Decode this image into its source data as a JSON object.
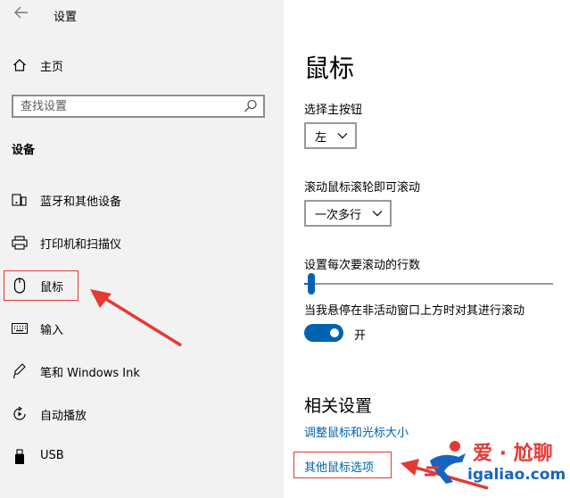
{
  "window": {
    "title": "设置"
  },
  "sidebar": {
    "home_label": "主页",
    "search_placeholder": "查找设置",
    "section_title": "设备",
    "items": [
      {
        "label": "蓝牙和其他设备",
        "icon": "bluetooth-devices-icon"
      },
      {
        "label": "打印机和扫描仪",
        "icon": "printer-icon"
      },
      {
        "label": "鼠标",
        "icon": "mouse-icon"
      },
      {
        "label": "输入",
        "icon": "keyboard-icon"
      },
      {
        "label": "笔和 Windows Ink",
        "icon": "pen-icon"
      },
      {
        "label": "自动播放",
        "icon": "autoplay-icon"
      },
      {
        "label": "USB",
        "icon": "usb-icon"
      }
    ]
  },
  "main": {
    "page_title": "鼠标",
    "primary_button": {
      "label": "选择主按钮",
      "value": "左"
    },
    "scroll_wheel": {
      "label": "滚动鼠标滚轮即可滚动",
      "value": "一次多行"
    },
    "lines_per_scroll": {
      "label": "设置每次要滚动的行数",
      "value_percent": 3
    },
    "inactive_scroll": {
      "label": "当我悬停在非活动窗口上方时对其进行滚动",
      "state": "开"
    },
    "related": {
      "heading": "相关设置",
      "links": [
        "调整鼠标和光标大小",
        "其他鼠标选项"
      ]
    }
  },
  "watermark": {
    "line1": "爱 · 尬聊",
    "line2": "igaliao.com"
  },
  "colors": {
    "accent": "#0063b1",
    "annotation": "#e53935",
    "sidebar_bg": "#f2f2f2"
  }
}
